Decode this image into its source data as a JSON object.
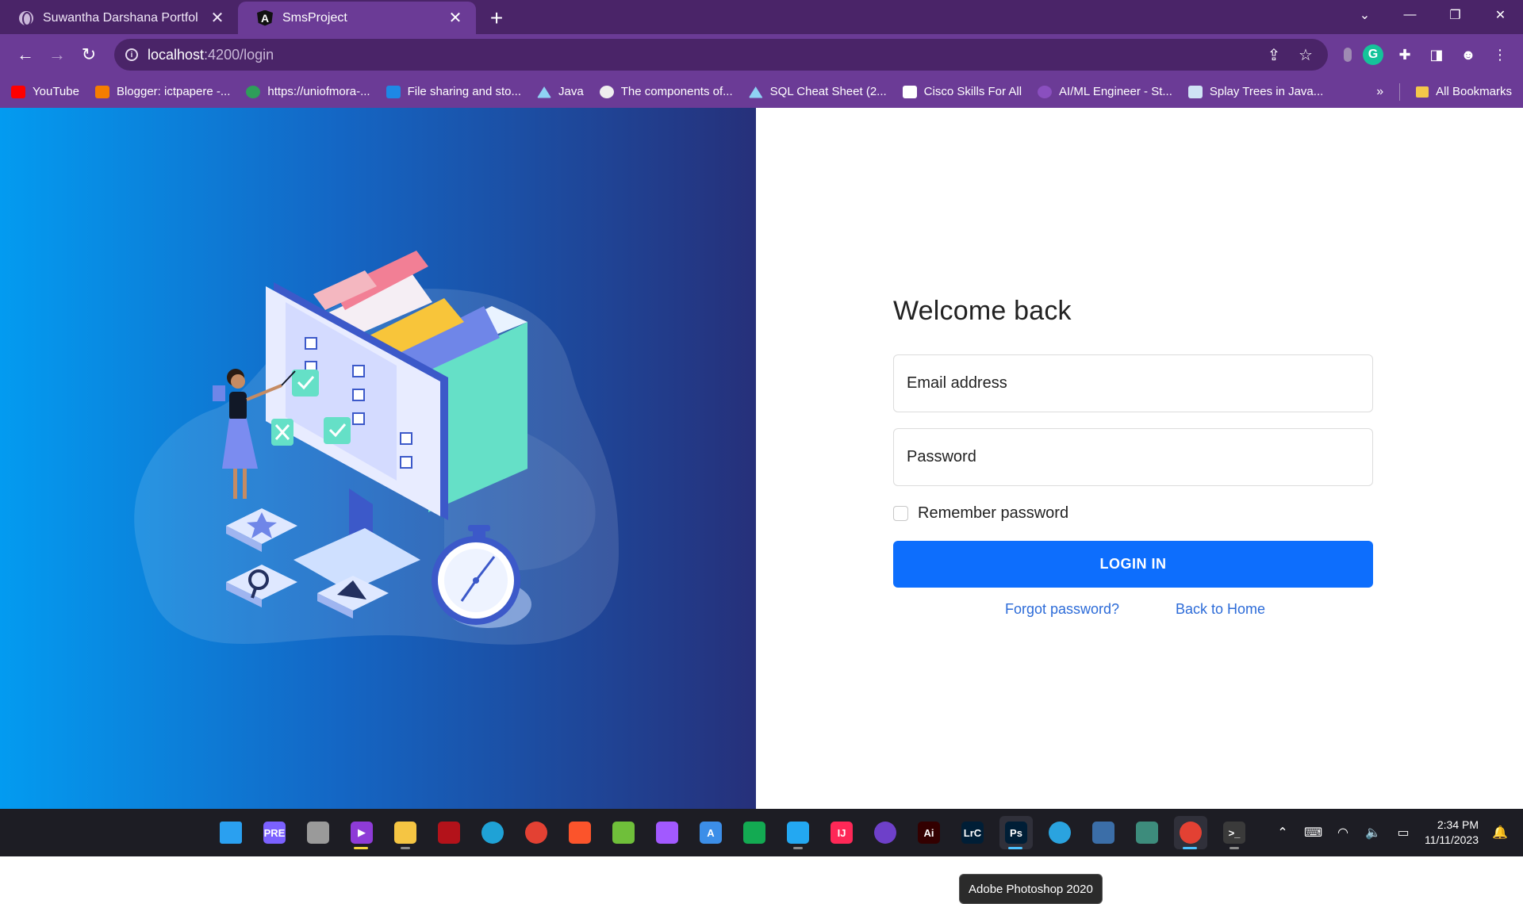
{
  "browser": {
    "tabs": [
      {
        "title": "Suwantha Darshana Portfolio",
        "active": false,
        "icon": "globe-icon"
      },
      {
        "title": "SmsProject",
        "active": true,
        "icon": "angular-logo-icon"
      }
    ],
    "url_host": "localhost",
    "url_path": ":4200/login",
    "bookmarks": [
      {
        "label": "YouTube",
        "color": "#ff0000"
      },
      {
        "label": "Blogger: ictpapere -...",
        "color": "#f57d00"
      },
      {
        "label": "https://uniofmora-...",
        "color": "#2f9e5a"
      },
      {
        "label": "File sharing and sto...",
        "color": "#1e88e5"
      },
      {
        "label": "Java",
        "color": "#8fd3f4"
      },
      {
        "label": "The components of...",
        "color": "#eeeeee"
      },
      {
        "label": "SQL Cheat Sheet (2...",
        "color": "#8fd3f4"
      },
      {
        "label": "Cisco Skills For All",
        "color": "#ffffff"
      },
      {
        "label": "AI/ML Engineer - St...",
        "color": "#8a4fbf"
      },
      {
        "label": "Splay Trees in Java...",
        "color": "#cfe3f5"
      }
    ],
    "bookmarks_more": "»",
    "all_bookmarks": "All Bookmarks"
  },
  "login": {
    "title": "Welcome back",
    "email_placeholder": "Email address",
    "password_placeholder": "Password",
    "remember_label": "Remember password",
    "login_button": "LOGIN IN",
    "forgot_link": "Forgot password?",
    "home_link": "Back to Home"
  },
  "tooltip": "Adobe Photoshop 2020",
  "taskbar": {
    "apps": [
      {
        "name": "start",
        "label": "",
        "color": "#2aa0f0"
      },
      {
        "name": "copilot",
        "label": "PRE",
        "color": "#7b61ff"
      },
      {
        "name": "task-view",
        "label": "",
        "color": "#9a9a9a"
      },
      {
        "name": "visual-studio",
        "label": "▶",
        "color": "#8e3bd7"
      },
      {
        "name": "file-explorer",
        "label": "",
        "color": "#f5c543"
      },
      {
        "name": "media",
        "label": "",
        "color": "#b3121a"
      },
      {
        "name": "edge",
        "label": "",
        "color": "#1fa2d6"
      },
      {
        "name": "chrome",
        "label": "",
        "color": "#e34133"
      },
      {
        "name": "brave",
        "label": "",
        "color": "#fb542b"
      },
      {
        "name": "dev-app",
        "label": "",
        "color": "#6fbf3a"
      },
      {
        "name": "figma",
        "label": "",
        "color": "#a259ff"
      },
      {
        "name": "android-studio",
        "label": "A",
        "color": "#3c8ee8"
      },
      {
        "name": "mongodb",
        "label": "",
        "color": "#13aa52"
      },
      {
        "name": "vscode",
        "label": "",
        "color": "#23a8f2"
      },
      {
        "name": "intellij",
        "label": "IJ",
        "color": "#fe2857"
      },
      {
        "name": "github",
        "label": "",
        "color": "#6e40c9"
      },
      {
        "name": "illustrator",
        "label": "Ai",
        "color": "#330000"
      },
      {
        "name": "lightroom-classic",
        "label": "LrC",
        "color": "#001e36"
      },
      {
        "name": "photoshop",
        "label": "Ps",
        "color": "#001e36"
      },
      {
        "name": "telegram",
        "label": "",
        "color": "#2aa3df"
      },
      {
        "name": "mysql-workbench",
        "label": "",
        "color": "#3b6ea8"
      },
      {
        "name": "chatgpt",
        "label": "",
        "color": "#3d8c7c"
      },
      {
        "name": "chrome-active",
        "label": "",
        "color": "#e34133"
      },
      {
        "name": "terminal",
        "label": ">_",
        "color": "#3a3a3a"
      }
    ],
    "time": "2:34 PM",
    "date": "11/11/2023"
  }
}
